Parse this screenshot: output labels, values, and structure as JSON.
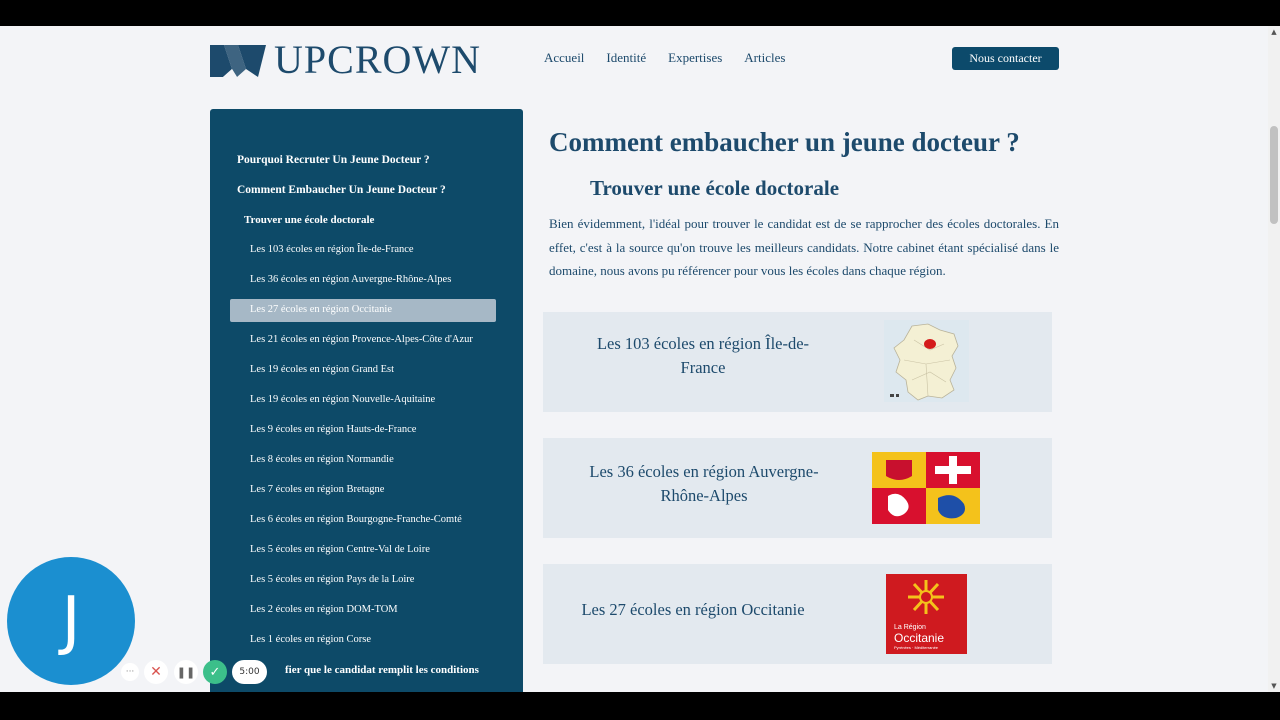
{
  "brand": {
    "name": "UPCROWN"
  },
  "nav": {
    "items": [
      "Accueil",
      "Identité",
      "Expertises",
      "Articles"
    ],
    "contact": "Nous contacter"
  },
  "toc": {
    "items": [
      {
        "label": "Pourquoi Recruter Un Jeune Docteur ?",
        "level": 1
      },
      {
        "label": "Comment Embaucher Un Jeune Docteur ?",
        "level": 1
      },
      {
        "label": "Trouver une école doctorale",
        "level": 2
      },
      {
        "label": "Les 103 écoles en région Île-de-France",
        "level": 3
      },
      {
        "label": "Les 36 écoles en région Auvergne-Rhône-Alpes",
        "level": 3
      },
      {
        "label": "Les 27 écoles en région Occitanie",
        "level": 3,
        "active": true
      },
      {
        "label": "Les 21 écoles en région Provence-Alpes-Côte d'Azur",
        "level": 3
      },
      {
        "label": "Les 19 écoles en région Grand Est",
        "level": 3
      },
      {
        "label": "Les 19 écoles en région Nouvelle-Aquitaine",
        "level": 3
      },
      {
        "label": "Les 9 écoles en région Hauts-de-France",
        "level": 3
      },
      {
        "label": "Les 8 écoles en région Normandie",
        "level": 3
      },
      {
        "label": "Les 7 écoles en région Bretagne",
        "level": 3
      },
      {
        "label": "Les 6 écoles en région Bourgogne-Franche-Comté",
        "level": 3
      },
      {
        "label": "Les 5 écoles en région Centre-Val de Loire",
        "level": 3
      },
      {
        "label": "Les 5 écoles en région Pays de la Loire",
        "level": 3
      },
      {
        "label": "Les 2 écoles en région DOM-TOM",
        "level": 3
      },
      {
        "label": "Les 1 écoles en région Corse",
        "level": 3
      },
      {
        "label": "fier que le candidat remplit les conditions",
        "level": 2
      }
    ]
  },
  "main": {
    "title": "Comment embaucher un jeune docteur ?",
    "subtitle": "Trouver une école doctorale",
    "intro": "Bien évidemment, l'idéal pour trouver le candidat est de se rapprocher des écoles doctorales. En effet, c'est à la source qu'on trouve les meilleurs candidats. Notre cabinet étant spécialisé dans le domaine, nous avons pu référencer pour vous les écoles dans chaque région.",
    "cards": [
      {
        "title": "Les 103 écoles en région Île-de-France",
        "image": "map-france-idf"
      },
      {
        "title": "Les 36 écoles en région Auvergne-Rhône-Alpes",
        "image": "flag-auvergne-rhone-alpes"
      },
      {
        "title": "Les 27 écoles en région Occitanie",
        "image": "logo-occitanie",
        "logo_text": {
          "line1": "La Région",
          "line2": "Occitanie",
          "line3": "Pyrénées · Méditerranée"
        }
      }
    ]
  },
  "recorder": {
    "avatar_letter": "J",
    "timer": "5:00"
  },
  "colors": {
    "primary": "#0d4a68",
    "text": "#1d4a6c",
    "card_bg": "#e3e9ef",
    "recorder_blue": "#1b8fd0",
    "ok_green": "#3cbf8a"
  }
}
